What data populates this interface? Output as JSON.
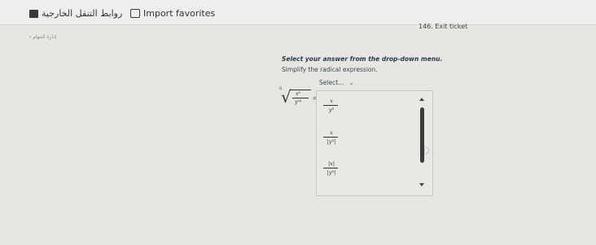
{
  "bookmarks": [
    {
      "label": "روابط التنقل الخارجية",
      "icon": "folder-icon"
    },
    {
      "label": "Import favorites",
      "icon": "bookmark-icon"
    }
  ],
  "page": {
    "back_link": "‹ إدارة المهام",
    "ticket": "146. Exit ticket",
    "instruction": "Select your answer from the drop-down menu.",
    "prompt": "Simplify the radical expression."
  },
  "expression": {
    "index": "8",
    "numerator": "x⁸",
    "denominator": "y²⁴",
    "equals": "="
  },
  "dropdown": {
    "selected": "Select...",
    "options": [
      {
        "numerator": "x",
        "denominator": "y³"
      },
      {
        "numerator": "x",
        "denominator": "|y³|"
      },
      {
        "numerator": "|x|",
        "denominator": "|y³|"
      }
    ]
  }
}
